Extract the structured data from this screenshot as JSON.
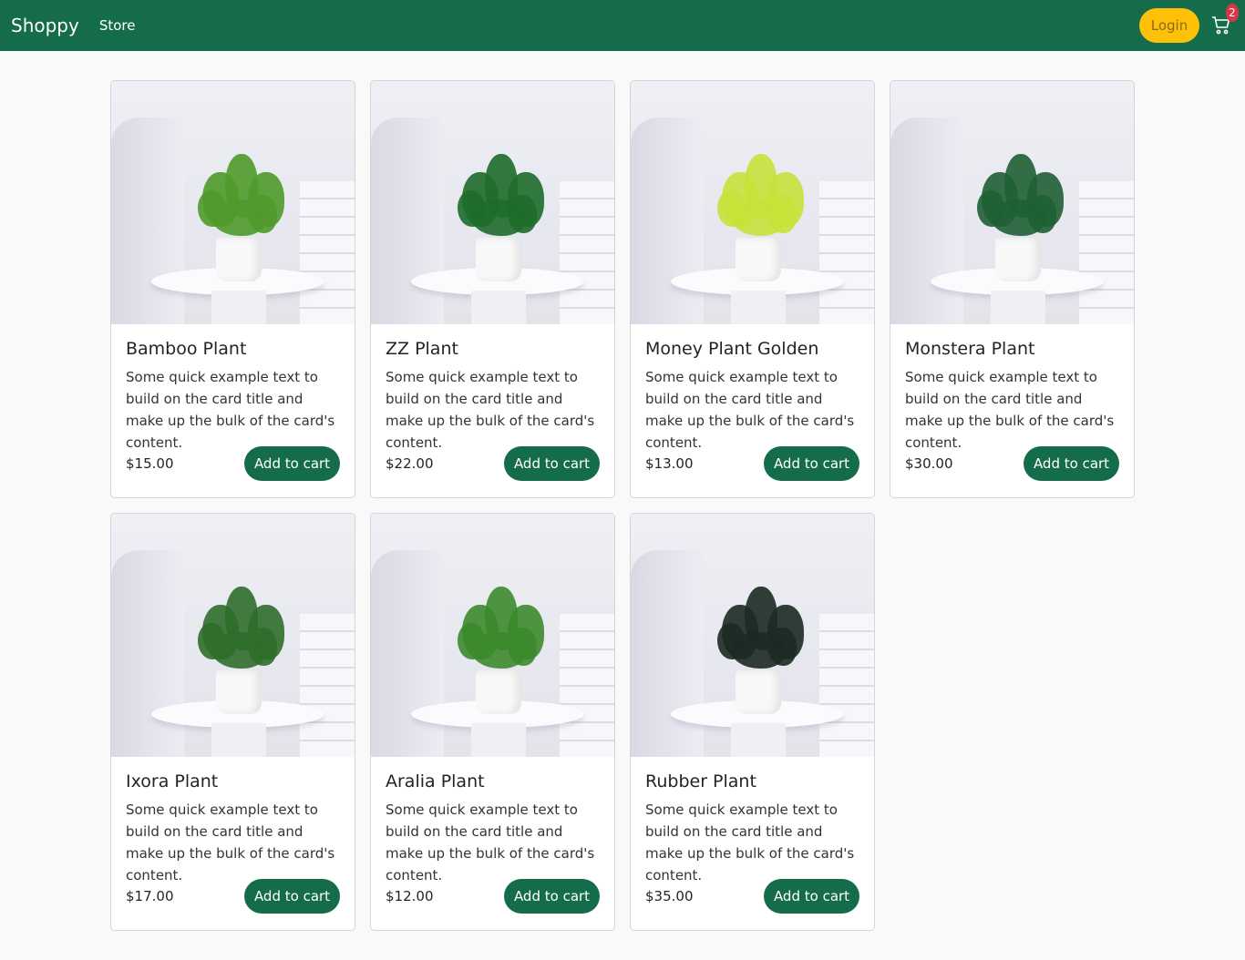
{
  "navbar": {
    "brand": "Shoppy",
    "store_link": "Store",
    "login_label": "Login",
    "cart_count": "2"
  },
  "colors": {
    "brand_green": "#146c4b",
    "login_yellow": "#ffc107",
    "badge_red": "#dc3545"
  },
  "products": [
    {
      "title": "Bamboo Plant",
      "text": "Some quick example text to build on the card title and make up the bulk of the card's content.",
      "price": "$15.00",
      "button": "Add to cart",
      "leaf_color": "#4f9a2a"
    },
    {
      "title": "ZZ Plant",
      "text": "Some quick example text to build on the card title and make up the bulk of the card's content.",
      "price": "$22.00",
      "button": "Add to cart",
      "leaf_color": "#1e6b2a"
    },
    {
      "title": "Money Plant Golden",
      "text": "Some quick example text to build on the card title and make up the bulk of the card's content.",
      "price": "$13.00",
      "button": "Add to cart",
      "leaf_color": "#c6e23a"
    },
    {
      "title": "Monstera Plant",
      "text": "Some quick example text to build on the card title and make up the bulk of the card's content.",
      "price": "$30.00",
      "button": "Add to cart",
      "leaf_color": "#1f5f34"
    },
    {
      "title": "Ixora Plant",
      "text": "Some quick example text to build on the card title and make up the bulk of the card's content.",
      "price": "$17.00",
      "button": "Add to cart",
      "leaf_color": "#2f6d2a"
    },
    {
      "title": "Aralia Plant",
      "text": "Some quick example text to build on the card title and make up the bulk of the card's content.",
      "price": "$12.00",
      "button": "Add to cart",
      "leaf_color": "#3c8a2c"
    },
    {
      "title": "Rubber Plant",
      "text": "Some quick example text to build on the card title and make up the bulk of the card's content.",
      "price": "$35.00",
      "button": "Add to cart",
      "leaf_color": "#1c2a22"
    }
  ]
}
